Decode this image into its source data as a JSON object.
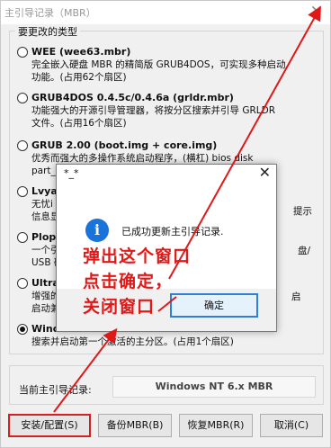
{
  "window": {
    "title": "主引导记录（MBR）",
    "close": "✕"
  },
  "group": {
    "legend": "要更改的类型",
    "options": [
      {
        "title": "WEE (wee63.mbr)",
        "desc": [
          "完全嵌入硬盘 MBR 的精简版 GRUB4DOS，可实现多种启动",
          "功能。(占用62个扇区)"
        ],
        "checked": false
      },
      {
        "title": "GRUB4DOS 0.4.5c/0.4.6a (grldr.mbr)",
        "desc": [
          "功能强大的开源引导管理器，将按分区搜索并引导 GRLDR",
          "文件。(占用16个扇区)"
        ],
        "checked": false
      },
      {
        "title": "GRUB 2.00 (boot.img + core.img)",
        "desc": [
          "优秀而强大的多操作系统启动程序，(横杠) bios disk",
          "part_r"
        ],
        "checked": false
      },
      {
        "title": "Lvyan",
        "desc": [
          "无忧i",
          "信息显"
        ],
        "desc_right": "提示",
        "checked": false
      },
      {
        "title": "Plop",
        "desc": [
          "一个引",
          "USB 磁"
        ],
        "desc_right": "盘/",
        "checked": false
      },
      {
        "title": "Ultral",
        "desc": [
          "增强的",
          "启动兼容"
        ],
        "desc_right": "启",
        "checked": false
      },
      {
        "title": "Windows NT 6.x MBR",
        "desc": [
          "搜索并启动第一个激活的主分区。(占用1个扇区)"
        ],
        "checked": true
      }
    ]
  },
  "current": {
    "label": "当前主引导记录:",
    "value": "Windows NT 6.x MBR"
  },
  "buttons": {
    "install": "安装/配置(S)",
    "backup": "备份MBR(B)",
    "restore": "恢复MBR(R)",
    "cancel": "取消(C)"
  },
  "dialog": {
    "title": "*_*",
    "close": "✕",
    "icon": "i",
    "message": "已成功更新主引导记录.",
    "ok": "确定"
  },
  "annotation": {
    "lines": [
      "弹出这个窗口",
      "点击确定，",
      "关闭窗口"
    ]
  },
  "colors": {
    "annotation": "#e01818",
    "ok_border": "#2f7fd6",
    "info_icon": "#1a73d9"
  }
}
